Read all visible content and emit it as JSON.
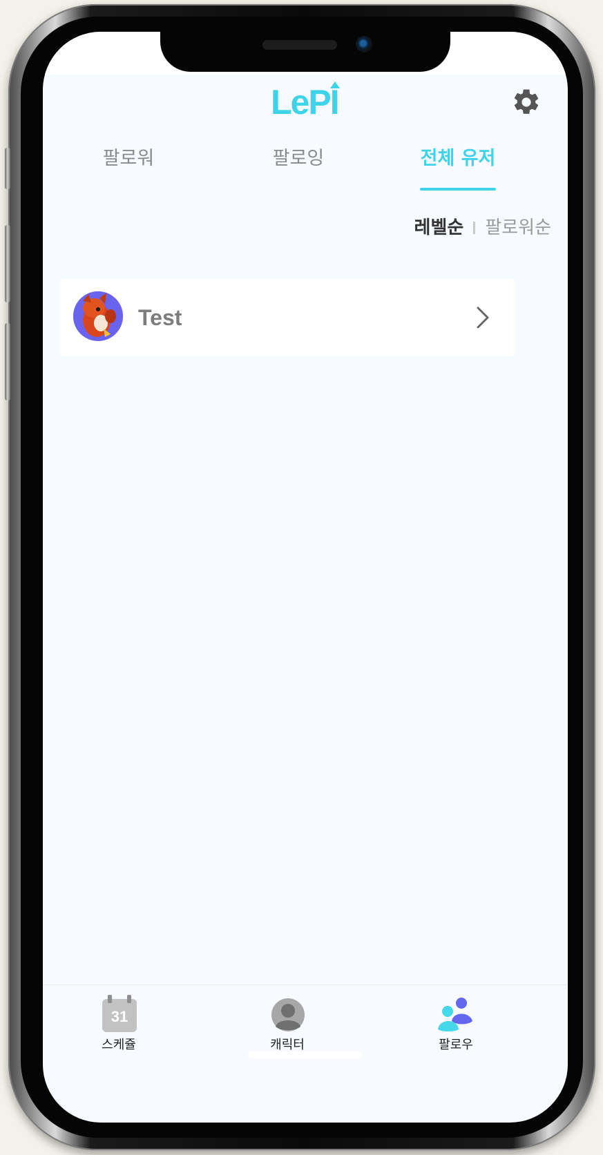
{
  "app": {
    "logo_text": "LePI",
    "accent_color": "#3fd3e9"
  },
  "header": {
    "settings_icon": "gear-icon"
  },
  "tabs": [
    {
      "label": "팔로워",
      "active": false
    },
    {
      "label": "팔로잉",
      "active": false
    },
    {
      "label": "전체 유저",
      "active": true
    }
  ],
  "sort": {
    "active_label": "레벨순",
    "inactive_label": "팔로워순"
  },
  "users": [
    {
      "name": "Test",
      "avatar_icon": "character-avatar-icon"
    }
  ],
  "bottom_nav": [
    {
      "label": "스케쥴",
      "icon": "calendar-icon",
      "icon_text": "31",
      "active": false
    },
    {
      "label": "캐릭터",
      "icon": "person-icon",
      "active": false
    },
    {
      "label": "팔로우",
      "icon": "follow-users-icon",
      "active": true
    }
  ]
}
